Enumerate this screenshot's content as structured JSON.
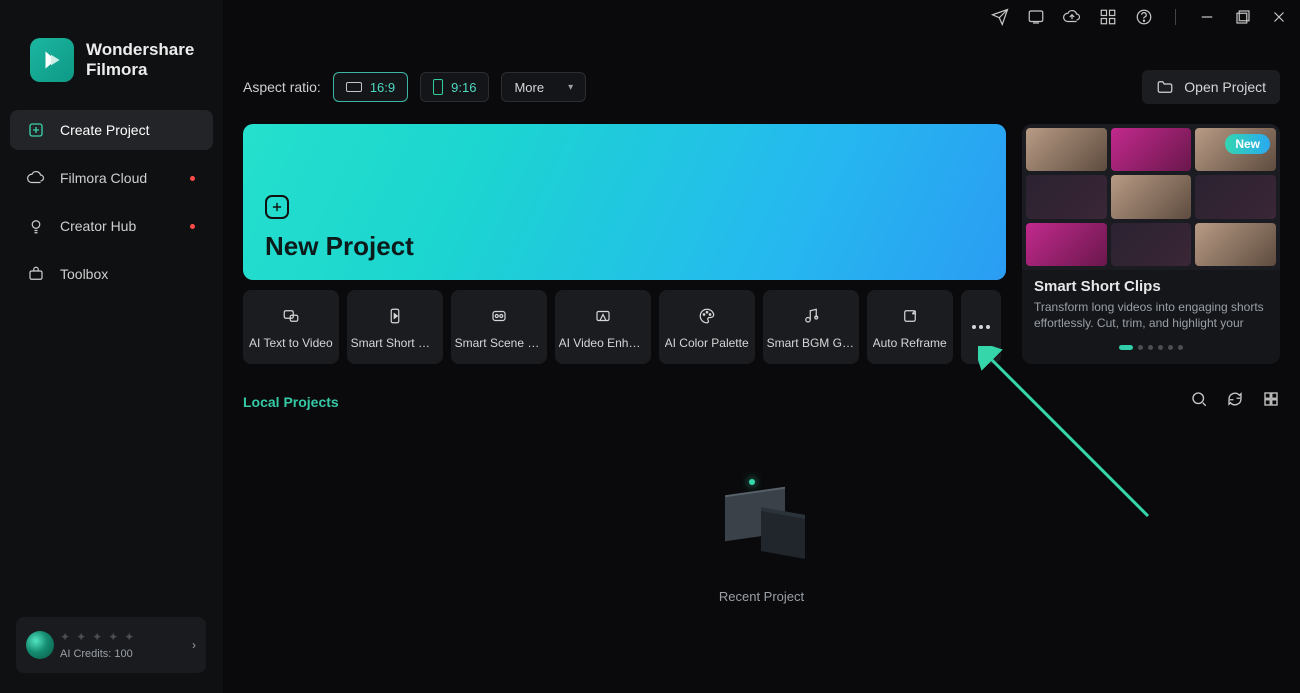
{
  "brand": {
    "line1": "Wondershare",
    "line2": "Filmora"
  },
  "sidebar": {
    "items": [
      {
        "label": "Create Project"
      },
      {
        "label": "Filmora Cloud"
      },
      {
        "label": "Creator Hub"
      },
      {
        "label": "Toolbox"
      }
    ]
  },
  "credits": {
    "label": "AI Credits: 100"
  },
  "toprow": {
    "aspect_label": "Aspect ratio:",
    "ratio_16_9": "16:9",
    "ratio_9_16": "9:16",
    "more": "More",
    "open_project": "Open Project"
  },
  "hero": {
    "title": "New Project"
  },
  "tools": [
    {
      "label": "AI Text to Video"
    },
    {
      "label": "Smart Short Cli..."
    },
    {
      "label": "Smart Scene Cut"
    },
    {
      "label": "AI Video Enhan..."
    },
    {
      "label": "AI Color Palette"
    },
    {
      "label": "Smart BGM Ge..."
    },
    {
      "label": "Auto Reframe"
    }
  ],
  "promo": {
    "badge": "New",
    "title": "Smart Short Clips",
    "desc": "Transform long videos into engaging shorts effortlessly. Cut, trim, and highlight your best..."
  },
  "projects": {
    "tab": "Local Projects",
    "empty_label": "Recent Project"
  }
}
